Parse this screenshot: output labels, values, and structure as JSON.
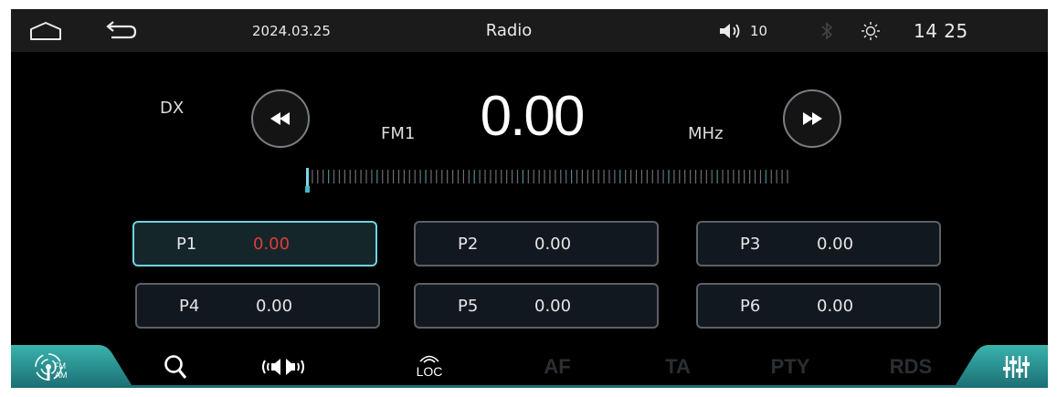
{
  "status_bar": {
    "date": "2024.03.25",
    "title": "Radio",
    "volume_level": "10",
    "clock": "14 25",
    "icons": [
      "home-icon",
      "back-icon",
      "volume-icon",
      "bluetooth-icon",
      "brightness-icon"
    ]
  },
  "radio": {
    "mode": "DX",
    "band": "FM1",
    "frequency": "0.00",
    "unit": "MHz",
    "tuner_position": 0
  },
  "presets": [
    {
      "label": "P1",
      "value": "0.00",
      "active": true
    },
    {
      "label": "P2",
      "value": "0.00",
      "active": false
    },
    {
      "label": "P3",
      "value": "0.00",
      "active": false
    },
    {
      "label": "P4",
      "value": "0.00",
      "active": false
    },
    {
      "label": "P5",
      "value": "0.00",
      "active": false
    },
    {
      "label": "P6",
      "value": "0.00",
      "active": false
    }
  ],
  "bottom_bar": {
    "band_switch_fm": "FM",
    "band_switch_am": "AM",
    "loc_label": "LOC",
    "af": "AF",
    "ta": "TA",
    "pty": "PTY",
    "rds": "RDS",
    "icons": [
      "fm-am-switch-icon",
      "search-icon",
      "stereo-icon",
      "loc-icon",
      "equalizer-icon"
    ]
  },
  "colors": {
    "accent": "#2fa39a",
    "active_preset_border": "#6fd3e0",
    "active_preset_value": "#e23a3a",
    "disabled_text": "#2b2f33"
  }
}
